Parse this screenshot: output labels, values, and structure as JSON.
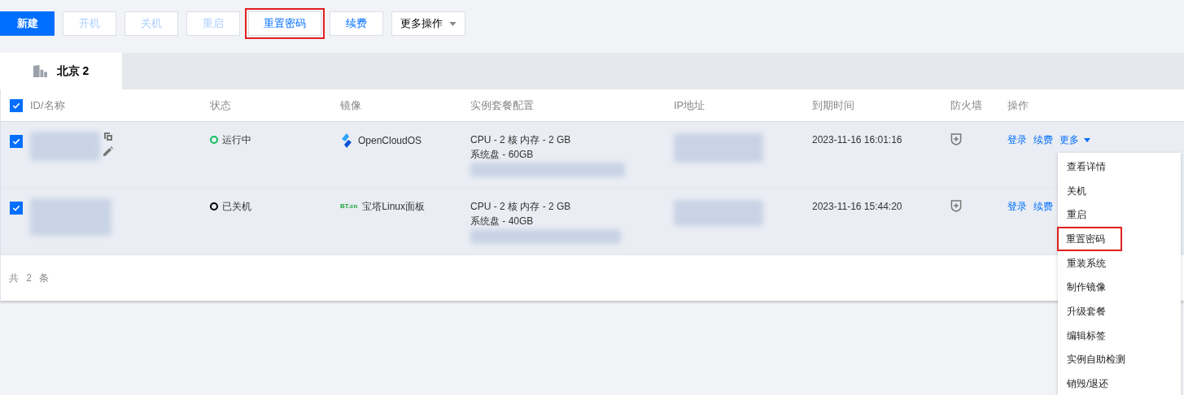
{
  "toolbar": [
    {
      "label": "新建",
      "kind": "primary",
      "disabled": false,
      "highlighted": false
    },
    {
      "label": "开机",
      "kind": "default",
      "disabled": true,
      "highlighted": false
    },
    {
      "label": "关机",
      "kind": "default",
      "disabled": true,
      "highlighted": false
    },
    {
      "label": "重启",
      "kind": "default",
      "disabled": true,
      "highlighted": false
    },
    {
      "label": "重置密码",
      "kind": "default",
      "disabled": false,
      "highlighted": true
    },
    {
      "label": "续费",
      "kind": "default",
      "disabled": false,
      "highlighted": false
    },
    {
      "label": "更多操作",
      "kind": "dropdown",
      "disabled": false,
      "highlighted": false
    }
  ],
  "tabs": [
    {
      "label": "北京 2",
      "selected": true
    }
  ],
  "table": {
    "select_all": {
      "checked": true
    },
    "columns": [
      "ID/名称",
      "状态",
      "镜像",
      "实例套餐配置",
      "IP地址",
      "到期时间",
      "防火墙",
      "操作"
    ],
    "rows": [
      {
        "selected": true,
        "editable": true,
        "status": {
          "kind": "running",
          "label": "运行中"
        },
        "image": {
          "kind": "opencloudos",
          "label": "OpenCloudOS"
        },
        "config": [
          "CPU - 2 核 内存 - 2 GB",
          "系统盘 - 60GB"
        ],
        "expires": "2023-11-16 16:01:16",
        "actions": [
          "登录",
          "续费"
        ],
        "more": "更多"
      },
      {
        "selected": true,
        "editable": false,
        "status": {
          "kind": "stopped",
          "label": "已关机"
        },
        "image": {
          "kind": "bt",
          "label": "宝塔Linux面板",
          "logo": "BT.cn"
        },
        "config": [
          "CPU - 2 核 内存 - 2 GB",
          "系统盘 - 40GB"
        ],
        "expires": "2023-11-16 15:44:20",
        "actions": [
          "登录",
          "续费"
        ]
      }
    ],
    "footer": "共 2 条"
  },
  "menu": [
    {
      "label": "查看详情",
      "highlighted": false
    },
    {
      "label": "关机",
      "highlighted": false
    },
    {
      "label": "重启",
      "highlighted": false
    },
    {
      "label": "重置密码",
      "highlighted": true
    },
    {
      "label": "重装系统",
      "highlighted": false
    },
    {
      "label": "制作镜像",
      "highlighted": false
    },
    {
      "label": "升级套餐",
      "highlighted": false
    },
    {
      "label": "编辑标签",
      "highlighted": false
    },
    {
      "label": "实例自助检测",
      "highlighted": false
    },
    {
      "label": "销毁/退还",
      "highlighted": false
    }
  ]
}
